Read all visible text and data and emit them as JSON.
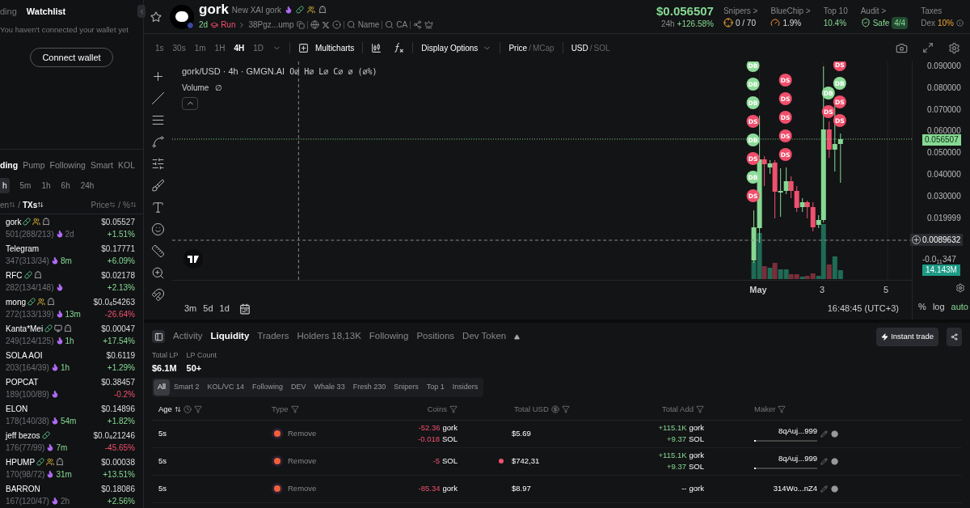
{
  "sidebar": {
    "top_tabs": [
      {
        "label": "ding",
        "selected": false
      },
      {
        "label": "Watchlist",
        "selected": true
      }
    ],
    "wallet_message": "You haven't connected your wallet yet",
    "connect_button": "Connect wallet",
    "list_tabs": [
      {
        "label": "ding",
        "selected": true
      },
      {
        "label": "Pump",
        "selected": false
      },
      {
        "label": "Following",
        "selected": false
      },
      {
        "label": "Smart",
        "selected": false
      },
      {
        "label": "KOL",
        "selected": false
      }
    ],
    "timeframes": [
      {
        "label": "h",
        "selected": true
      },
      {
        "label": "5m",
        "selected": false
      },
      {
        "label": "1h",
        "selected": false
      },
      {
        "label": "6h",
        "selected": false
      },
      {
        "label": "24h",
        "selected": false
      }
    ],
    "list_header": {
      "separator": "/",
      "left": [
        {
          "label": "en",
          "active": false
        },
        {
          "label": "TXs",
          "active": true
        }
      ],
      "right": [
        {
          "label": "Price",
          "active": false
        },
        {
          "label": "%",
          "active": false
        }
      ]
    },
    "tokens": [
      {
        "name": "gork",
        "badges": [
          {
            "kind": "pill"
          },
          {
            "kind": "group"
          },
          {
            "kind": "bot"
          }
        ],
        "stats": "501(288/213)",
        "age": "2d",
        "age_recent": false,
        "price": "$0.05527",
        "change": "+1.51%",
        "negative": false
      },
      {
        "name": "Telegram",
        "stats": "347(313/34)",
        "age": "8m",
        "age_recent": true,
        "price": "$0.17771",
        "change": "+6.09%",
        "negative": false
      },
      {
        "name": "RFC",
        "badges": [
          {
            "kind": "pill"
          },
          {
            "kind": "bot"
          }
        ],
        "stats": "282(134/148)",
        "price": "$0.02178",
        "change": "+2.13%",
        "negative": false
      },
      {
        "name": "mong",
        "badges": [
          {
            "kind": "pill"
          },
          {
            "kind": "group"
          },
          {
            "kind": "bot"
          }
        ],
        "stats": "272(133/139)",
        "age": "13m",
        "age_recent": true,
        "price": "$0.0$_{4}$54263",
        "change": "-26.64%",
        "negative": true
      },
      {
        "name": "Kanta*Mei",
        "badges": [
          {
            "kind": "pill"
          },
          {
            "kind": "screen"
          },
          {
            "kind": "bot"
          }
        ],
        "stats": "249(124/125)",
        "age": "1h",
        "age_recent": true,
        "price": "$0.00047",
        "change": "+17.54%",
        "negative": false
      },
      {
        "name": "SOLA AOI",
        "stats": "203(164/39)",
        "age": "1h",
        "age_recent": true,
        "price": "$0.6119",
        "change": "+1.29%",
        "negative": false
      },
      {
        "name": "POPCAT",
        "stats": "189(100/89)",
        "price": "$0.38457",
        "change": "-0.2%",
        "negative": true
      },
      {
        "name": "ELON",
        "stats": "178(140/38)",
        "age": "54m",
        "age_recent": true,
        "price": "$0.14896",
        "change": "+1.82%",
        "negative": false
      },
      {
        "name": "jeff bezos",
        "badges": [
          {
            "kind": "pill"
          }
        ],
        "stats": "176(77/99)",
        "age": "7m",
        "age_recent": true,
        "price": "$0.0$_{4}$21246",
        "change": "-45.65%",
        "negative": true
      },
      {
        "name": "HPUMP",
        "badges": [
          {
            "kind": "pill"
          },
          {
            "kind": "group"
          },
          {
            "kind": "bot"
          }
        ],
        "stats": "170(98/72)",
        "age": "31m",
        "age_recent": true,
        "price": "$0.00038",
        "change": "+13.51%",
        "negative": false
      },
      {
        "name": "BARRON",
        "stats": "167(120/47)",
        "age": "2h",
        "age_recent": false,
        "price": "$0.18086",
        "change": "+2.56%",
        "negative": false
      }
    ]
  },
  "token": {
    "symbol": "gork",
    "full_name": "New XAI gork",
    "age": "2d",
    "launch": "Run",
    "address": "38Pgz...ump",
    "search_name": "Name",
    "search_ca": "CA",
    "price": "$0.056507",
    "period": "24h",
    "period_change": "+126.58%",
    "stats": [
      {
        "kind": "snipers",
        "label": "Snipers >",
        "value": "0 / 70"
      },
      {
        "kind": "bluechip",
        "label": "BlueChip >",
        "value": "1.9%"
      },
      {
        "kind": "top10",
        "label": "Top 10",
        "value": "10.4%"
      },
      {
        "kind": "audit",
        "label": "Audit >",
        "value": "Safe",
        "badge": "4/4"
      },
      {
        "kind": "taxes",
        "label": "Taxes",
        "prefix": "Dex",
        "value": "10%"
      }
    ]
  },
  "toolbar": {
    "intervals": [
      {
        "label": "1s",
        "selected": false
      },
      {
        "label": "30s",
        "selected": false
      },
      {
        "label": "1m",
        "selected": false
      },
      {
        "label": "1H",
        "selected": false
      },
      {
        "label": "4H",
        "selected": true
      },
      {
        "label": "1D",
        "selected": false
      }
    ],
    "multicharts": "Multicharts",
    "display_options": "Display Options",
    "separator": "/",
    "price_mode": [
      {
        "label": "Price",
        "selected": true
      },
      {
        "label": "MCap",
        "selected": false
      }
    ],
    "currency": [
      {
        "label": "USD",
        "selected": true
      },
      {
        "label": "SOL",
        "selected": false
      }
    ]
  },
  "chart": {
    "legend": "gork/USD · 4h · GMGN.AI",
    "ohlc": "O∅ H∅ L∅ C∅ ∅ (∅%)",
    "volume_label": "Volume",
    "volume_value": "∅",
    "price_ticks": [
      "0.090000",
      "0.080000",
      "0.070000",
      "0.060000",
      "0.050000",
      "0.040000",
      "0.030000",
      "0.019999"
    ],
    "current_price": "0.056507",
    "crosshair_price": "0.0089632",
    "low_tick": "-0.0$_{11}$347",
    "volume_badge": "14.143M",
    "signals": [
      [
        {
          "label": "DB",
          "kind": "buy"
        },
        {
          "label": "DB",
          "kind": "buy"
        },
        {
          "label": "DB",
          "kind": "buy"
        },
        {
          "label": "DS",
          "kind": "sell"
        },
        {
          "label": "DB",
          "kind": "buy"
        },
        {
          "label": "DS",
          "kind": "sell"
        },
        {
          "label": "DB",
          "kind": "buy"
        },
        {
          "label": "DS",
          "kind": "sell"
        }
      ],
      [
        {
          "label": "DS",
          "kind": "sell"
        },
        {
          "label": "DS",
          "kind": "sell"
        },
        {
          "label": "DS",
          "kind": "sell"
        },
        {
          "label": "DS",
          "kind": "sell"
        },
        {
          "label": "DS",
          "kind": "sell"
        }
      ],
      [
        {
          "label": "DB",
          "kind": "buy"
        },
        {
          "label": "DS",
          "kind": "sell"
        }
      ],
      [
        {
          "label": "DS",
          "kind": "sell"
        },
        {
          "label": "DB",
          "kind": "buy"
        },
        {
          "label": "DS",
          "kind": "sell"
        },
        {
          "label": "DS",
          "kind": "sell"
        }
      ]
    ],
    "x_labels": [
      "May",
      "3",
      "5"
    ],
    "ranges": [
      "3m",
      "5d",
      "1d"
    ],
    "clock": "16:48:45 (UTC+3)",
    "scale_modes": [
      {
        "label": "%",
        "selected": false
      },
      {
        "label": "log",
        "selected": false
      },
      {
        "label": "auto",
        "selected": true
      }
    ]
  },
  "panel": {
    "tabs": [
      {
        "label": "Activity",
        "selected": false
      },
      {
        "label": "Liquidity",
        "selected": true
      },
      {
        "label": "Traders",
        "selected": false
      },
      {
        "label": "Holders 18,13K",
        "selected": false
      },
      {
        "label": "Following",
        "selected": false
      },
      {
        "label": "Positions",
        "selected": false
      },
      {
        "label": "Dev Token",
        "selected": false
      }
    ],
    "instant_trade": "Instant trade",
    "summary": [
      {
        "label": "Total LP",
        "value": "$6.1M"
      },
      {
        "label": "LP Count",
        "value": "50+"
      }
    ],
    "filters": [
      {
        "label": "All",
        "selected": true
      },
      {
        "label": "Smart 2",
        "selected": false
      },
      {
        "label": "KOL/VC 14",
        "selected": false
      },
      {
        "label": "Following",
        "selected": false
      },
      {
        "label": "DEV",
        "selected": false
      },
      {
        "label": "Whale 33",
        "selected": false
      },
      {
        "label": "Fresh 230",
        "selected": false
      },
      {
        "label": "Snipers",
        "selected": false
      },
      {
        "label": "Top 1",
        "selected": false
      },
      {
        "label": "Insiders",
        "selected": false
      }
    ],
    "columns": [
      "Age",
      "Type",
      "Coins",
      "Total USD",
      "Total Add",
      "Maker"
    ],
    "rows": [
      {
        "age": "5s",
        "type": "Remove",
        "coins": [
          {
            "amount": "-52.36",
            "unit": "gork"
          },
          {
            "amount": "-0.018",
            "unit": "SOL"
          }
        ],
        "flagged": false,
        "total_usd": "$5.69",
        "total_add": [
          {
            "amount": "+115.1K",
            "unit": "gork",
            "positive": true
          },
          {
            "amount": "+9.37",
            "unit": "SOL",
            "positive": true
          }
        ],
        "maker": "8qAuj...999",
        "level": 0.03
      },
      {
        "age": "5s",
        "type": "Remove",
        "coins": [
          {
            "amount": "-5",
            "unit": "SOL"
          }
        ],
        "flagged": true,
        "total_usd": "$742,31",
        "total_add": [
          {
            "amount": "+115.1K",
            "unit": "gork",
            "positive": true
          },
          {
            "amount": "+9.37",
            "unit": "SOL",
            "positive": true
          }
        ],
        "maker": "8qAuj...999",
        "level": 0.03
      },
      {
        "age": "5s",
        "type": "Remove",
        "coins": [
          {
            "amount": "-85.34",
            "unit": "gork"
          }
        ],
        "flagged": false,
        "total_usd": "$8.97",
        "total_add": [
          {
            "amount": "--",
            "unit": "gork",
            "positive": false
          }
        ],
        "maker": "314Wo...nZ4"
      }
    ]
  }
}
